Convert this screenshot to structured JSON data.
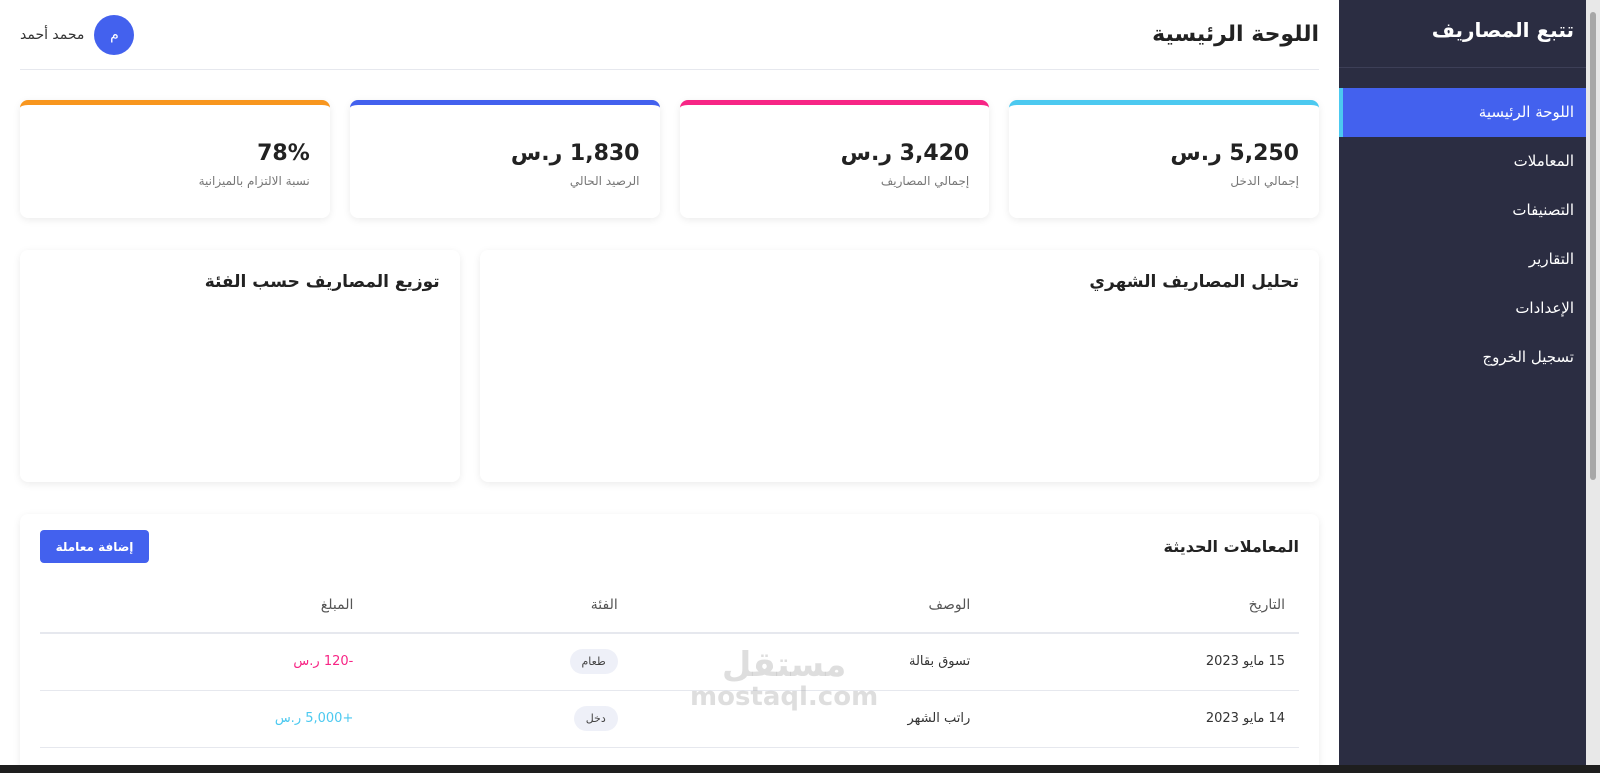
{
  "sidebar": {
    "app_title": "تتبع المصاريف",
    "items": [
      {
        "label": "اللوحة الرئيسية",
        "active": true
      },
      {
        "label": "المعاملات"
      },
      {
        "label": "التصنيفات"
      },
      {
        "label": "التقارير"
      },
      {
        "label": "الإعدادات"
      },
      {
        "label": "تسجيل الخروج"
      }
    ]
  },
  "header": {
    "title": "اللوحة الرئيسية",
    "user_name": "محمد أحمد",
    "avatar_initial": "م"
  },
  "stats": [
    {
      "value": "5,250 ر.س",
      "label": "إجمالي الدخل",
      "accent": "#4cc9f0"
    },
    {
      "value": "3,420 ر.س",
      "label": "إجمالي المصاريف",
      "accent": "#f72585"
    },
    {
      "value": "1,830 ر.س",
      "label": "الرصيد الحالي",
      "accent": "#4361ee"
    },
    {
      "value": "78%",
      "label": "نسبة الالتزام بالميزانية",
      "accent": "#f8961e"
    }
  ],
  "charts": {
    "monthly_title": "تحليل المصاريف الشهري",
    "category_title": "توزيع المصاريف حسب الفئة"
  },
  "transactions": {
    "title": "المعاملات الحديثة",
    "add_button": "إضافة معاملة",
    "columns": [
      "التاريخ",
      "الوصف",
      "الفئة",
      "المبلغ"
    ],
    "rows": [
      {
        "date": "15 مايو 2023",
        "description": "تسوق بقالة",
        "category": "طعام",
        "amount": "-120 ر.س",
        "type": "expense"
      },
      {
        "date": "14 مايو 2023",
        "description": "راتب الشهر",
        "category": "دخل",
        "amount": "+5,000 ر.س",
        "type": "income"
      }
    ]
  },
  "watermark": {
    "line1": "مستقل",
    "line2": "mostaql.com"
  },
  "colors": {
    "sidebar_bg": "#2b2d42",
    "primary": "#4361ee",
    "income": "#4cc9f0",
    "expense": "#f72585",
    "warning": "#f8961e"
  }
}
